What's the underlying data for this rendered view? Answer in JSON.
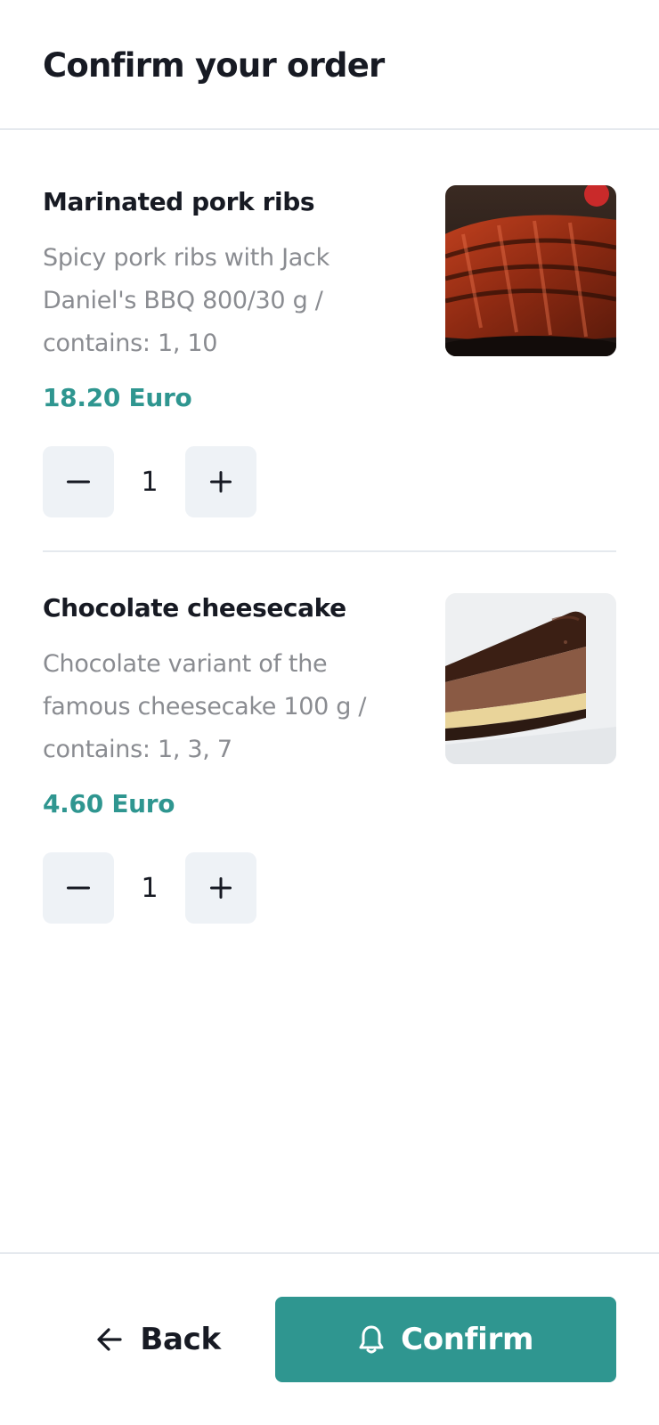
{
  "header": {
    "title": "Confirm your order"
  },
  "items": [
    {
      "name": "Marinated pork ribs",
      "description": "Spicy pork ribs with Jack Daniel's BBQ 800/30 g / contains: 1, 10",
      "price": "18.20 Euro",
      "quantity": "1",
      "image_icon": "pork-ribs-image"
    },
    {
      "name": "Chocolate cheesecake",
      "description": "Chocolate variant of the famous cheesecake 100 g / contains: 1, 3, 7",
      "price": "4.60 Euro",
      "quantity": "1",
      "image_icon": "cheesecake-image"
    }
  ],
  "stepper": {
    "minus": "−",
    "plus": "+"
  },
  "footer": {
    "back_label": "Back",
    "confirm_label": "Confirm"
  },
  "colors": {
    "accent": "#2f9690",
    "text": "#171a23",
    "muted": "#8a8c91",
    "stepper_bg": "#eef2f6"
  }
}
